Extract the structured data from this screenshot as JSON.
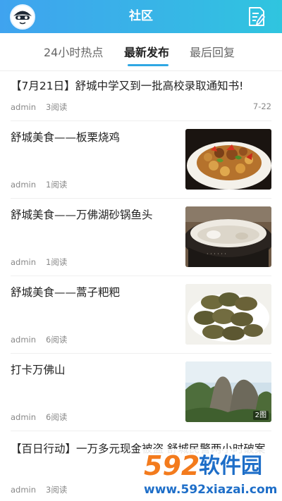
{
  "header": {
    "title": "社区",
    "avatar_icon": "cartoon-avatar-icon",
    "compose_icon": "compose-note-icon"
  },
  "tabs": [
    {
      "label": "24小时热点",
      "active": false
    },
    {
      "label": "最新发布",
      "active": true
    },
    {
      "label": "最后回复",
      "active": false
    }
  ],
  "posts": [
    {
      "title": "【7月21日】舒城中学又到一批高校录取通知书!",
      "author": "admin",
      "reads": "3阅读",
      "date": "7-22"
    },
    {
      "title": "舒城美食——板栗烧鸡",
      "author": "admin",
      "reads": "1阅读",
      "image": "braised-chicken-with-chestnuts"
    },
    {
      "title": "舒城美食——万佛湖砂锅鱼头",
      "author": "admin",
      "reads": "1阅读",
      "image": "fish-head-soup-in-clay-pot"
    },
    {
      "title": "舒城美食——蒿子粑粑",
      "author": "admin",
      "reads": "6阅读",
      "image": "artemisia-rice-cakes"
    },
    {
      "title": "打卡万佛山",
      "author": "admin",
      "reads": "6阅读",
      "image": "wanfo-mountain-peaks",
      "badge": "2图"
    },
    {
      "title": "【百日行动】一万多元现金被盗 舒城民警两小时破案",
      "author": "admin",
      "reads": "3阅读"
    }
  ],
  "watermark": {
    "logo_digits": "592",
    "logo_text": "软件园",
    "url": "www.592xiazai.com"
  },
  "colors": {
    "header_start": "#3fa3ef",
    "header_end": "#2fc5df",
    "accent": "#2fa7e3",
    "watermark_orange": "#f37b1d",
    "watermark_blue": "#1e6ec8"
  }
}
